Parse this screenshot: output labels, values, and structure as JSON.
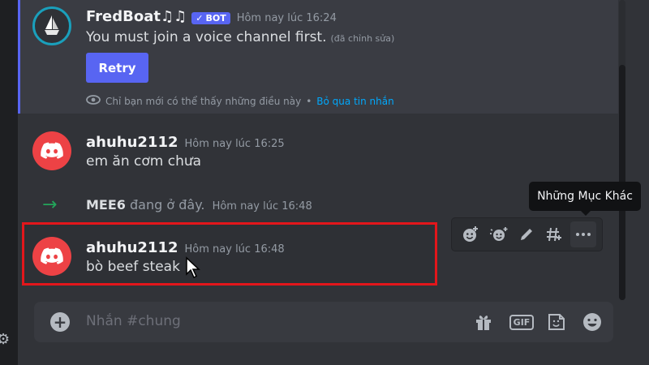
{
  "messages": [
    {
      "author": "FredBoat♫♫",
      "badge": "BOT",
      "timestamp": "Hôm nay lúc 16:24",
      "text": "You must join a voice channel first.",
      "edited": "(đã chỉnh sửa)",
      "button": "Retry",
      "ephemeral_note": "Chỉ bạn mới có thể thấy những điều này",
      "ephemeral_separator": "•",
      "dismiss_link": "Bỏ qua tin nhắn"
    },
    {
      "author": "ahuhu2112",
      "timestamp": "Hôm nay lúc 16:25",
      "text": "em ăn cơm chưa"
    },
    {
      "author": "ahuhu2112",
      "timestamp": "Hôm nay lúc 16:48",
      "text": "bò beef steak"
    }
  ],
  "join": {
    "name": "MEE6",
    "text": "đang ở đây.",
    "timestamp": "Hôm nay lúc 16:48"
  },
  "tooltip": "Những Mục Khác",
  "toolbar_icons": [
    "add-reaction-icon",
    "super-reaction-icon",
    "edit-icon",
    "thread-icon",
    "more-icon"
  ],
  "composer": {
    "placeholder": "Nhắn #chung",
    "gif_label": "GIF"
  },
  "colors": {
    "accent": "#5865f2",
    "highlight_border": "#e3161b",
    "link": "#00a8fc",
    "join_arrow": "#23a55a"
  }
}
